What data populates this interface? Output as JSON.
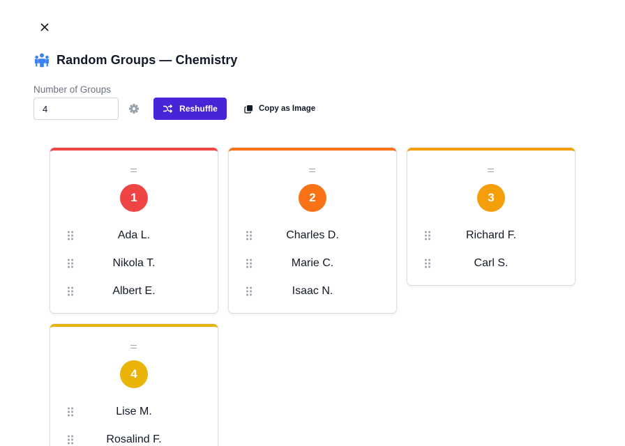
{
  "header": {
    "title": "Random Groups — Chemistry"
  },
  "controls": {
    "num_groups_label": "Number of Groups",
    "num_groups_value": "4",
    "reshuffle_label": "Reshuffle",
    "copy_label": "Copy as Image"
  },
  "icons": {
    "close": "close-icon",
    "title": "people-group-icon",
    "settings": "gear-icon",
    "reshuffle": "shuffle-icon",
    "copy": "copy-icon",
    "drag": "drag-handle-icon",
    "grip": "grip-dots-icon"
  },
  "colors": {
    "accent": "#4725d6",
    "title_icon": "#3b82f6"
  },
  "groups": [
    {
      "number": "1",
      "color": "#ef4444",
      "members": [
        "Ada L.",
        "Nikola T.",
        "Albert E."
      ]
    },
    {
      "number": "2",
      "color": "#f97316",
      "members": [
        "Charles D.",
        "Marie C.",
        "Isaac N."
      ]
    },
    {
      "number": "3",
      "color": "#f59e0b",
      "members": [
        "Richard F.",
        "Carl S."
      ]
    },
    {
      "number": "4",
      "color": "#eab308",
      "members": [
        "Lise M.",
        "Rosalind F."
      ]
    }
  ]
}
